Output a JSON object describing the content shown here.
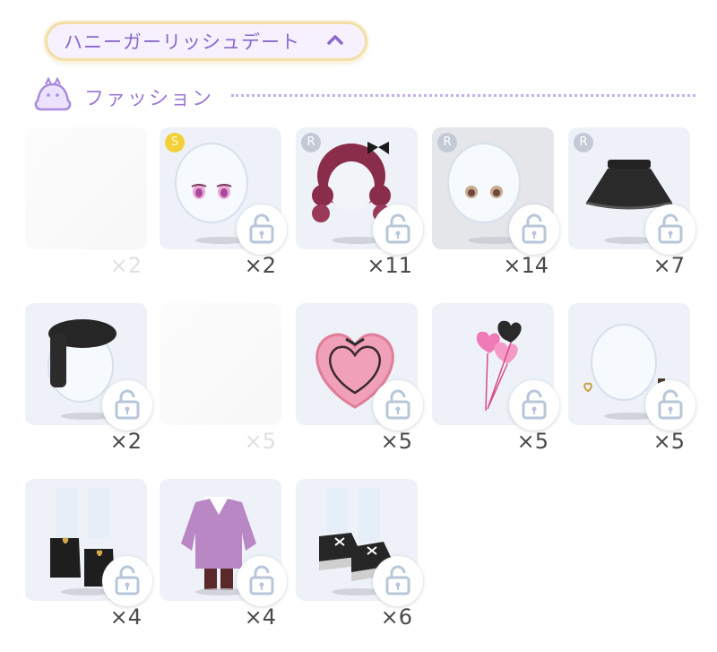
{
  "header": {
    "title": "ハニーガーリッシュデート"
  },
  "section": {
    "label": "ファッション"
  },
  "items": [
    {
      "name": "bust-pose",
      "rarity": "",
      "count": "×2"
    },
    {
      "name": "eyes-pink",
      "rarity": "S",
      "count": "×2"
    },
    {
      "name": "hair-wavy-burgundy",
      "rarity": "R",
      "count": "×11"
    },
    {
      "name": "eyes-brown",
      "rarity": "R",
      "count": "×14"
    },
    {
      "name": "skirt-black-tulle",
      "rarity": "R",
      "count": "×7"
    },
    {
      "name": "hat-black-beret",
      "rarity": "",
      "count": "×2"
    },
    {
      "name": "white-blank",
      "rarity": "",
      "count": "×5"
    },
    {
      "name": "heart-cookie",
      "rarity": "",
      "count": "×5"
    },
    {
      "name": "heart-balloons",
      "rarity": "",
      "count": "×5"
    },
    {
      "name": "heart-earrings",
      "rarity": "",
      "count": "×5"
    },
    {
      "name": "boots-heart-buckle",
      "rarity": "",
      "count": "×4"
    },
    {
      "name": "outfit-purple-jacket",
      "rarity": "",
      "count": "×4"
    },
    {
      "name": "sneakers-black",
      "rarity": "",
      "count": "×6"
    }
  ]
}
